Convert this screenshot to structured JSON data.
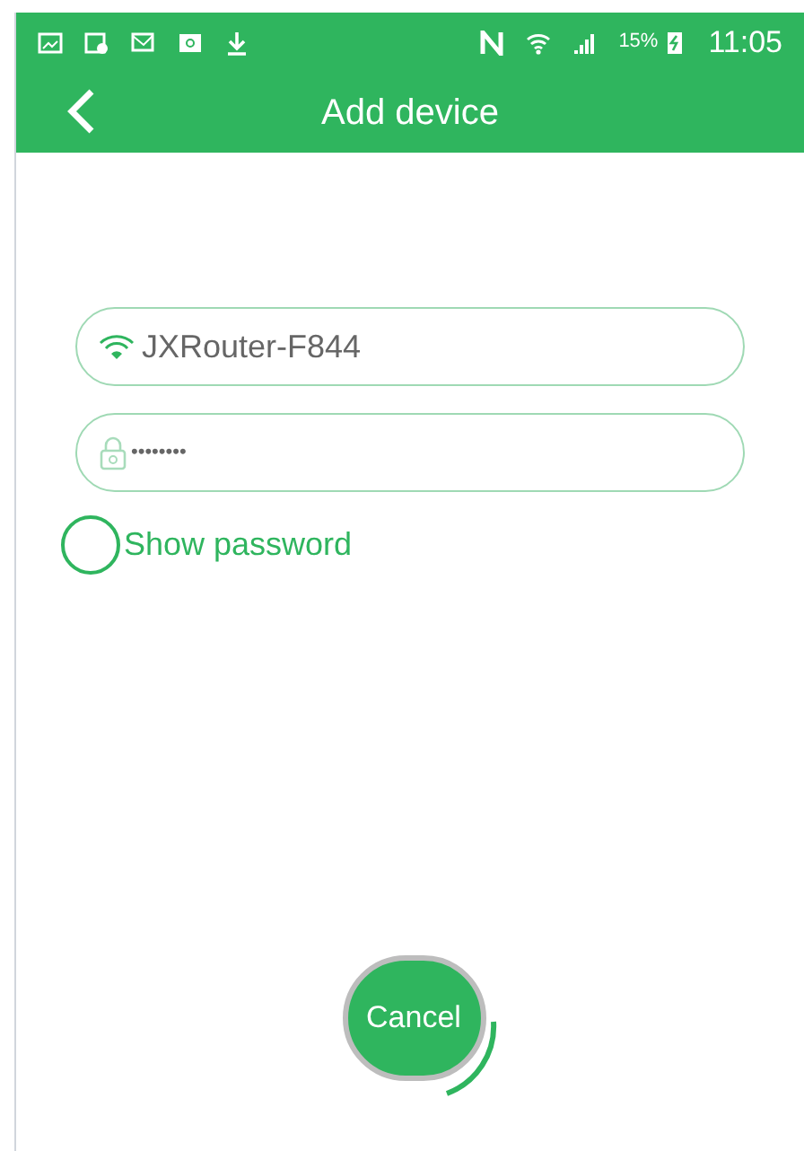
{
  "status_bar": {
    "battery_text": "15%",
    "time": "11:05"
  },
  "header": {
    "title": "Add device"
  },
  "ssid_field": {
    "value": "JXRouter-F844"
  },
  "password_field": {
    "value": "••••••••"
  },
  "show_password": {
    "label": "Show password",
    "checked": false
  },
  "cancel_button": {
    "label": "Cancel"
  }
}
